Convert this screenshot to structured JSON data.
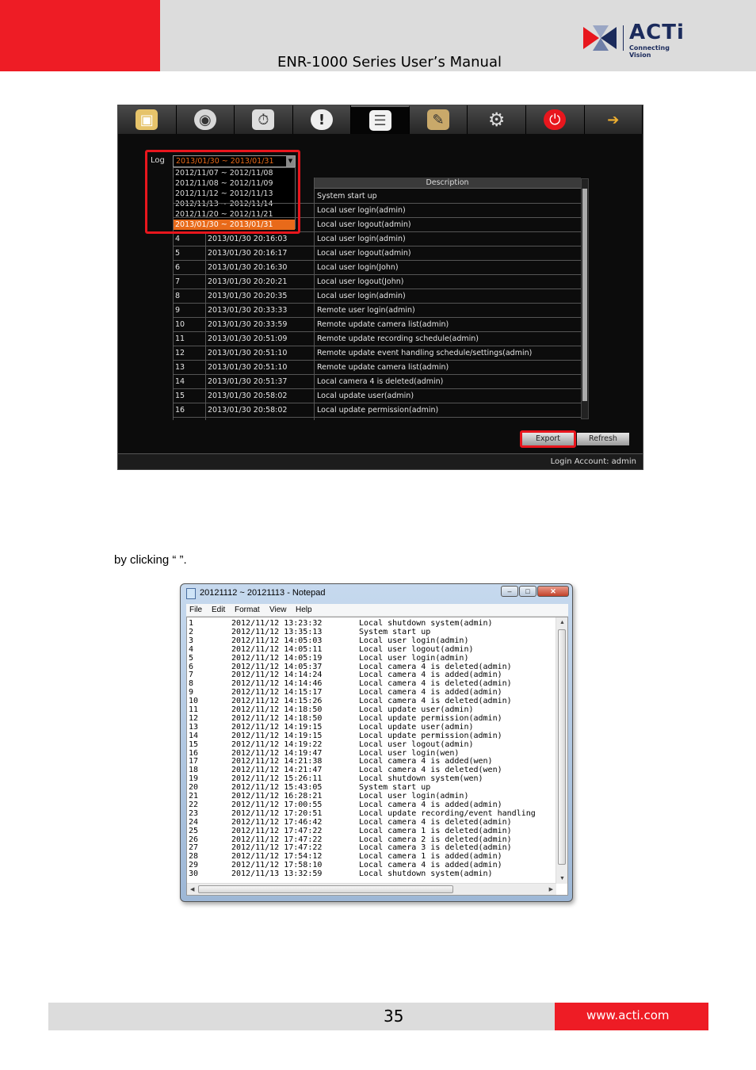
{
  "header": {
    "title": "ENR-1000 Series User’s Manual",
    "logo_text": "ACTi",
    "logo_sub": "Connecting Vision"
  },
  "nvr": {
    "tabs": [
      "monitor-icon",
      "camera-icon",
      "playback-icon",
      "event-icon",
      "log-icon",
      "setup-icon",
      "settings-icon",
      "power-icon",
      "logout-icon"
    ],
    "log_label": "Log",
    "log_selected": "2013/01/30 ~ 2013/01/31",
    "log_options": [
      "2012/11/07 ~ 2012/11/08",
      "2012/11/08 ~ 2012/11/09",
      "2012/11/12 ~ 2012/11/13",
      "2012/11/13 ~ 2012/11/14",
      "2012/11/20 ~ 2012/11/21",
      "2013/01/30 ~ 2013/01/31"
    ],
    "desc_header": "Description",
    "rows": [
      {
        "n": "",
        "t": "",
        "d": "System start up"
      },
      {
        "n": "",
        "t": "",
        "d": "Local user login(admin)"
      },
      {
        "n": "",
        "t": "",
        "d": "Local user logout(admin)"
      },
      {
        "n": "4",
        "t": "2013/01/30 20:16:03",
        "d": "Local user login(admin)"
      },
      {
        "n": "5",
        "t": "2013/01/30 20:16:17",
        "d": "Local user logout(admin)"
      },
      {
        "n": "6",
        "t": "2013/01/30 20:16:30",
        "d": "Local user login(John)"
      },
      {
        "n": "7",
        "t": "2013/01/30 20:20:21",
        "d": "Local user logout(John)"
      },
      {
        "n": "8",
        "t": "2013/01/30 20:20:35",
        "d": "Local user login(admin)"
      },
      {
        "n": "9",
        "t": "2013/01/30 20:33:33",
        "d": "Remote user login(admin)"
      },
      {
        "n": "10",
        "t": "2013/01/30 20:33:59",
        "d": "Remote update camera list(admin)"
      },
      {
        "n": "11",
        "t": "2013/01/30 20:51:09",
        "d": "Remote update recording schedule(admin)"
      },
      {
        "n": "12",
        "t": "2013/01/30 20:51:10",
        "d": "Remote update event handling schedule/settings(admin)"
      },
      {
        "n": "13",
        "t": "2013/01/30 20:51:10",
        "d": "Remote update camera list(admin)"
      },
      {
        "n": "14",
        "t": "2013/01/30 20:51:37",
        "d": "Local camera 4 is deleted(admin)"
      },
      {
        "n": "15",
        "t": "2013/01/30 20:58:02",
        "d": "Local update user(admin)"
      },
      {
        "n": "16",
        "t": "2013/01/30 20:58:02",
        "d": "Local update permission(admin)"
      }
    ],
    "export_label": "Export",
    "refresh_label": "Refresh",
    "status": "Login Account:  admin"
  },
  "caption": "by clicking “          ”.",
  "notepad": {
    "title": "20121112 ~ 20121113 - Notepad",
    "menu": [
      "File",
      "Edit",
      "Format",
      "View",
      "Help"
    ],
    "lines": [
      [
        "1",
        "2012/11/12 13:23:32",
        "Local shutdown system(admin)"
      ],
      [
        "2",
        "2012/11/12 13:35:13",
        "System start up"
      ],
      [
        "3",
        "2012/11/12 14:05:03",
        "Local user login(admin)"
      ],
      [
        "4",
        "2012/11/12 14:05:11",
        "Local user logout(admin)"
      ],
      [
        "5",
        "2012/11/12 14:05:19",
        "Local user login(admin)"
      ],
      [
        "6",
        "2012/11/12 14:05:37",
        "Local camera 4 is deleted(admin)"
      ],
      [
        "7",
        "2012/11/12 14:14:24",
        "Local camera 4 is added(admin)"
      ],
      [
        "8",
        "2012/11/12 14:14:46",
        "Local camera 4 is deleted(admin)"
      ],
      [
        "9",
        "2012/11/12 14:15:17",
        "Local camera 4 is added(admin)"
      ],
      [
        "10",
        "2012/11/12 14:15:26",
        "Local camera 4 is deleted(admin)"
      ],
      [
        "11",
        "2012/11/12 14:18:50",
        "Local update user(admin)"
      ],
      [
        "12",
        "2012/11/12 14:18:50",
        "Local update permission(admin)"
      ],
      [
        "13",
        "2012/11/12 14:19:15",
        "Local update user(admin)"
      ],
      [
        "14",
        "2012/11/12 14:19:15",
        "Local update permission(admin)"
      ],
      [
        "15",
        "2012/11/12 14:19:22",
        "Local user logout(admin)"
      ],
      [
        "16",
        "2012/11/12 14:19:47",
        "Local user login(wen)"
      ],
      [
        "17",
        "2012/11/12 14:21:38",
        "Local camera 4 is added(wen)"
      ],
      [
        "18",
        "2012/11/12 14:21:47",
        "Local camera 4 is deleted(wen)"
      ],
      [
        "19",
        "2012/11/12 15:26:11",
        "Local shutdown system(wen)"
      ],
      [
        "20",
        "2012/11/12 15:43:05",
        "System start up"
      ],
      [
        "21",
        "2012/11/12 16:28:21",
        "Local user login(admin)"
      ],
      [
        "22",
        "2012/11/12 17:00:55",
        "Local camera 4 is added(admin)"
      ],
      [
        "23",
        "2012/11/12 17:20:51",
        "Local update recording/event handling"
      ],
      [
        "24",
        "2012/11/12 17:46:42",
        "Local camera 4 is deleted(admin)"
      ],
      [
        "25",
        "2012/11/12 17:47:22",
        "Local camera 1 is deleted(admin)"
      ],
      [
        "26",
        "2012/11/12 17:47:22",
        "Local camera 2 is deleted(admin)"
      ],
      [
        "27",
        "2012/11/12 17:47:22",
        "Local camera 3 is deleted(admin)"
      ],
      [
        "28",
        "2012/11/12 17:54:12",
        "Local camera 1 is added(admin)"
      ],
      [
        "29",
        "2012/11/12 17:58:10",
        "Local camera 4 is added(admin)"
      ],
      [
        "30",
        "2012/11/13 13:32:59",
        "Local shutdown system(admin)"
      ]
    ]
  },
  "footer": {
    "page": "35",
    "url": "www.acti.com"
  }
}
